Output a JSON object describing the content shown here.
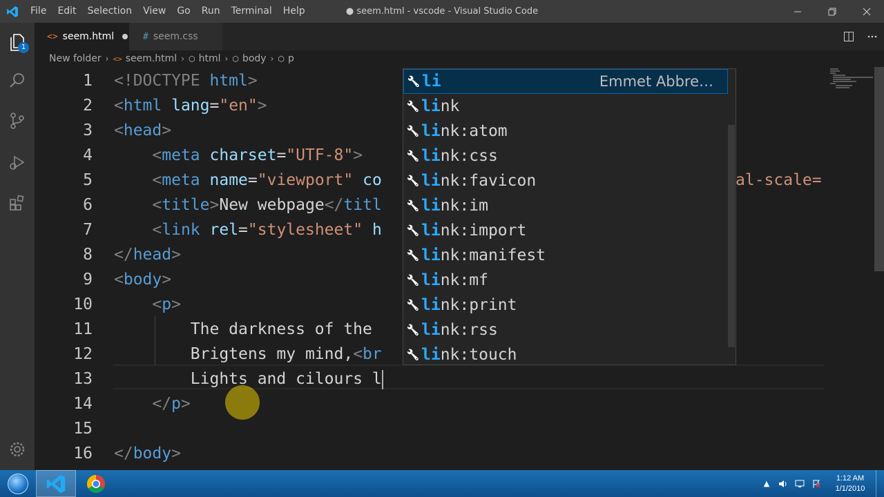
{
  "window": {
    "title": "● seem.html - vscode - Visual Studio Code",
    "menu": [
      "File",
      "Edit",
      "Selection",
      "View",
      "Go",
      "Run",
      "Terminal",
      "Help"
    ]
  },
  "activity_bar": {
    "items": [
      "explorer-icon",
      "search-icon",
      "source-control-icon",
      "run-debug-icon",
      "extensions-icon",
      "manage-gear-icon"
    ],
    "explorer_badge": "1"
  },
  "tabs": [
    {
      "label": "seem.html",
      "icon": "<>",
      "active": true,
      "dirty": true
    },
    {
      "label": "seem.css",
      "icon": "#",
      "active": false,
      "dirty": false
    }
  ],
  "breadcrumb": [
    "New folder",
    "seem.html",
    "html",
    "body",
    "p"
  ],
  "editor": {
    "line_numbers": [
      "1",
      "2",
      "3",
      "4",
      "5",
      "6",
      "7",
      "8",
      "9",
      "10",
      "11",
      "12",
      "13",
      "14",
      "15",
      "16"
    ],
    "lines": [
      [
        [
          "<!DOCTYPE ",
          "punc"
        ],
        [
          "html",
          "tag"
        ],
        [
          ">",
          "punc"
        ]
      ],
      [
        [
          "<",
          "punc"
        ],
        [
          "html",
          "tag"
        ],
        [
          " ",
          "txt"
        ],
        [
          "lang",
          "attr"
        ],
        [
          "=",
          "txt"
        ],
        [
          "\"en\"",
          "str"
        ],
        [
          ">",
          "punc"
        ]
      ],
      [
        [
          "<",
          "punc"
        ],
        [
          "head",
          "tag"
        ],
        [
          ">",
          "punc"
        ]
      ],
      [
        [
          "    ",
          "txt"
        ],
        [
          "<",
          "punc"
        ],
        [
          "meta",
          "tag"
        ],
        [
          " ",
          "txt"
        ],
        [
          "charset",
          "attr"
        ],
        [
          "=",
          "txt"
        ],
        [
          "\"UTF-8\"",
          "str"
        ],
        [
          ">",
          "punc"
        ]
      ],
      [
        [
          "    ",
          "txt"
        ],
        [
          "<",
          "punc"
        ],
        [
          "meta",
          "tag"
        ],
        [
          " ",
          "txt"
        ],
        [
          "name",
          "attr"
        ],
        [
          "=",
          "txt"
        ],
        [
          "\"viewport\"",
          "str"
        ],
        [
          " ",
          "txt"
        ],
        [
          "co",
          "attr"
        ]
      ],
      [
        [
          "    ",
          "txt"
        ],
        [
          "<",
          "punc"
        ],
        [
          "title",
          "tag"
        ],
        [
          ">",
          "punc"
        ],
        [
          "New webpage",
          "txt"
        ],
        [
          "</",
          "punc"
        ],
        [
          "titl",
          "tag"
        ]
      ],
      [
        [
          "    ",
          "txt"
        ],
        [
          "<",
          "punc"
        ],
        [
          "link",
          "tag"
        ],
        [
          " ",
          "txt"
        ],
        [
          "rel",
          "attr"
        ],
        [
          "=",
          "txt"
        ],
        [
          "\"stylesheet\"",
          "str"
        ],
        [
          " ",
          "txt"
        ],
        [
          "h",
          "attr"
        ]
      ],
      [
        [
          "</",
          "punc"
        ],
        [
          "head",
          "tag"
        ],
        [
          ">",
          "punc"
        ]
      ],
      [
        [
          "<",
          "punc"
        ],
        [
          "body",
          "tag"
        ],
        [
          ">",
          "punc"
        ]
      ],
      [
        [
          "    ",
          "txt"
        ],
        [
          "<",
          "punc"
        ],
        [
          "p",
          "tag"
        ],
        [
          ">",
          "punc"
        ]
      ],
      [
        [
          "        ",
          "txt"
        ],
        [
          "The darkness of the ",
          "txt"
        ]
      ],
      [
        [
          "        ",
          "txt"
        ],
        [
          "Brigtens my mind,",
          "txt"
        ],
        [
          "<",
          "punc"
        ],
        [
          "br",
          "tag"
        ]
      ],
      [
        [
          "        ",
          "txt"
        ],
        [
          "Lights and cilours l",
          "txt"
        ]
      ],
      [
        [
          "    ",
          "txt"
        ],
        [
          "</",
          "punc"
        ],
        [
          "p",
          "tag"
        ],
        [
          ">",
          "punc"
        ]
      ],
      [],
      [
        [
          "</",
          "punc"
        ],
        [
          "body",
          "tag"
        ],
        [
          ">",
          "punc"
        ]
      ]
    ],
    "line5_overflow": "al-scale="
  },
  "suggest": {
    "typed_prefix": "li",
    "items": [
      {
        "label": "li",
        "detail": "Emmet Abbre…",
        "selected": true
      },
      {
        "label": "link"
      },
      {
        "label": "link:atom"
      },
      {
        "label": "link:css"
      },
      {
        "label": "link:favicon"
      },
      {
        "label": "link:im"
      },
      {
        "label": "link:import"
      },
      {
        "label": "link:manifest"
      },
      {
        "label": "link:mf"
      },
      {
        "label": "link:print"
      },
      {
        "label": "link:rss"
      },
      {
        "label": "link:touch"
      }
    ]
  },
  "taskbar": {
    "apps": [
      "vscode-icon",
      "chrome-icon"
    ],
    "clock_time": "1:12 AM",
    "clock_date": "1/1/2010"
  },
  "colors": {
    "accent": "#0e70c0",
    "tag": "#569cd6",
    "attr": "#9cdcfe",
    "string": "#ce9178",
    "match": "#2aaaff"
  }
}
